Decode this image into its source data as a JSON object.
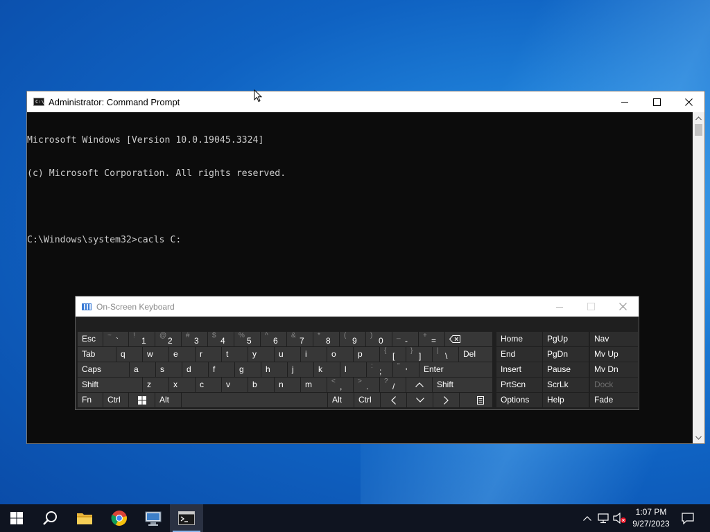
{
  "cmd": {
    "title": "Administrator: Command Prompt",
    "lines": [
      "Microsoft Windows [Version 10.0.19045.3324]",
      "(c) Microsoft Corporation. All rights reserved.",
      "",
      "C:\\Windows\\system32>cacls C:"
    ]
  },
  "osk": {
    "title": "On-Screen Keyboard",
    "keys": {
      "esc": "Esc",
      "tab": "Tab",
      "caps": "Caps",
      "shift_l": "Shift",
      "fn": "Fn",
      "ctrl_l": "Ctrl",
      "alt_l": "Alt",
      "alt_r": "Alt",
      "ctrl_r": "Ctrl",
      "shift_r": "Shift",
      "enter": "Enter",
      "del": "Del",
      "row1": [
        {
          "shift": "~",
          "low": "`"
        },
        {
          "shift": "!",
          "low": "1"
        },
        {
          "shift": "@",
          "low": "2"
        },
        {
          "shift": "#",
          "low": "3"
        },
        {
          "shift": "$",
          "low": "4"
        },
        {
          "shift": "%",
          "low": "5"
        },
        {
          "shift": "^",
          "low": "6"
        },
        {
          "shift": "&",
          "low": "7"
        },
        {
          "shift": "*",
          "low": "8"
        },
        {
          "shift": "(",
          "low": "9"
        },
        {
          "shift": ")",
          "low": "0"
        },
        {
          "shift": "_",
          "low": "-"
        },
        {
          "shift": "+",
          "low": "="
        }
      ],
      "row2": [
        "q",
        "w",
        "e",
        "r",
        "t",
        "y",
        "u",
        "i",
        "o",
        "p"
      ],
      "row2_sym": [
        {
          "shift": "{",
          "low": "["
        },
        {
          "shift": "}",
          "low": "]"
        },
        {
          "shift": "|",
          "low": "\\"
        }
      ],
      "row3": [
        "a",
        "s",
        "d",
        "f",
        "g",
        "h",
        "j",
        "k",
        "l"
      ],
      "row3_sym": [
        {
          "shift": ":",
          "low": ";"
        },
        {
          "shift": "\"",
          "low": "'"
        }
      ],
      "row4": [
        "z",
        "x",
        "c",
        "v",
        "b",
        "n",
        "m"
      ],
      "row4_sym": [
        {
          "shift": "<",
          "low": ","
        },
        {
          "shift": ">",
          "low": "."
        },
        {
          "shift": "?",
          "low": "/"
        }
      ],
      "nav": {
        "home": "Home",
        "pgup": "PgUp",
        "nav": "Nav",
        "end": "End",
        "pgdn": "PgDn",
        "mvup": "Mv Up",
        "insert": "Insert",
        "pause": "Pause",
        "mvdn": "Mv Dn",
        "prtscn": "PrtScn",
        "scrlk": "ScrLk",
        "dock": "Dock",
        "options": "Options",
        "help": "Help",
        "fade": "Fade"
      }
    }
  },
  "taskbar": {
    "apps": [
      "start-icon",
      "search-icon",
      "file-explorer-icon",
      "chrome-icon",
      "remote-desktop-icon",
      "command-prompt-icon"
    ],
    "clock": {
      "time": "1:07 PM",
      "date": "9/27/2023"
    }
  }
}
